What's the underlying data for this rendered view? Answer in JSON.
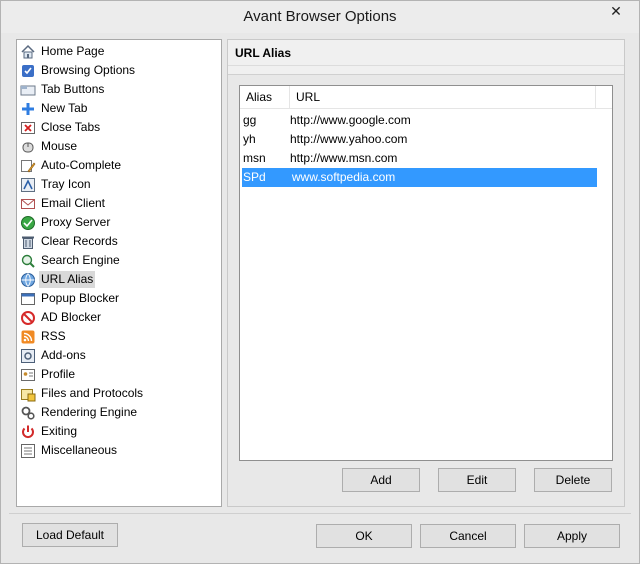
{
  "window": {
    "title": "Avant Browser Options"
  },
  "nav": {
    "items": [
      {
        "label": "Home Page",
        "icon": "home-icon"
      },
      {
        "label": "Browsing Options",
        "icon": "browsing-options-icon"
      },
      {
        "label": "Tab Buttons",
        "icon": "tab-buttons-icon"
      },
      {
        "label": "New Tab",
        "icon": "plus-icon"
      },
      {
        "label": "Close Tabs",
        "icon": "close-tabs-icon"
      },
      {
        "label": "Mouse",
        "icon": "mouse-icon"
      },
      {
        "label": "Auto-Complete",
        "icon": "auto-complete-icon"
      },
      {
        "label": "Tray Icon",
        "icon": "tray-icon"
      },
      {
        "label": "Email Client",
        "icon": "email-icon"
      },
      {
        "label": "Proxy Server",
        "icon": "proxy-server-icon"
      },
      {
        "label": "Clear Records",
        "icon": "trash-icon"
      },
      {
        "label": "Search Engine",
        "icon": "search-engine-icon"
      },
      {
        "label": "URL Alias",
        "icon": "globe-icon"
      },
      {
        "label": "Popup Blocker",
        "icon": "popup-blocker-icon"
      },
      {
        "label": "AD Blocker",
        "icon": "no-entry-icon"
      },
      {
        "label": "RSS",
        "icon": "rss-icon"
      },
      {
        "label": "Add-ons",
        "icon": "add-ons-icon"
      },
      {
        "label": "Profile",
        "icon": "profile-icon"
      },
      {
        "label": "Files and Protocols",
        "icon": "files-protocols-icon"
      },
      {
        "label": "Rendering Engine",
        "icon": "gears-icon"
      },
      {
        "label": "Exiting",
        "icon": "power-icon"
      },
      {
        "label": "Miscellaneous",
        "icon": "miscellaneous-icon"
      }
    ],
    "selected": "URL Alias"
  },
  "panel": {
    "title": "URL Alias",
    "columns": {
      "alias": "Alias",
      "url": "URL"
    },
    "rows": [
      {
        "alias": "gg",
        "url": "http://www.google.com"
      },
      {
        "alias": "yh",
        "url": "http://www.yahoo.com"
      },
      {
        "alias": "msn",
        "url": "http://www.msn.com"
      },
      {
        "alias": "SPd",
        "url": "www.softpedia.com"
      }
    ],
    "selected_alias": "SPd",
    "buttons": {
      "add": "Add",
      "edit": "Edit",
      "delete": "Delete"
    }
  },
  "footer": {
    "load_default": "Load Default",
    "ok": "OK",
    "cancel": "Cancel",
    "apply": "Apply"
  },
  "colors": {
    "selection": "#3399ff",
    "nav_selected": "#d9d9d9"
  }
}
